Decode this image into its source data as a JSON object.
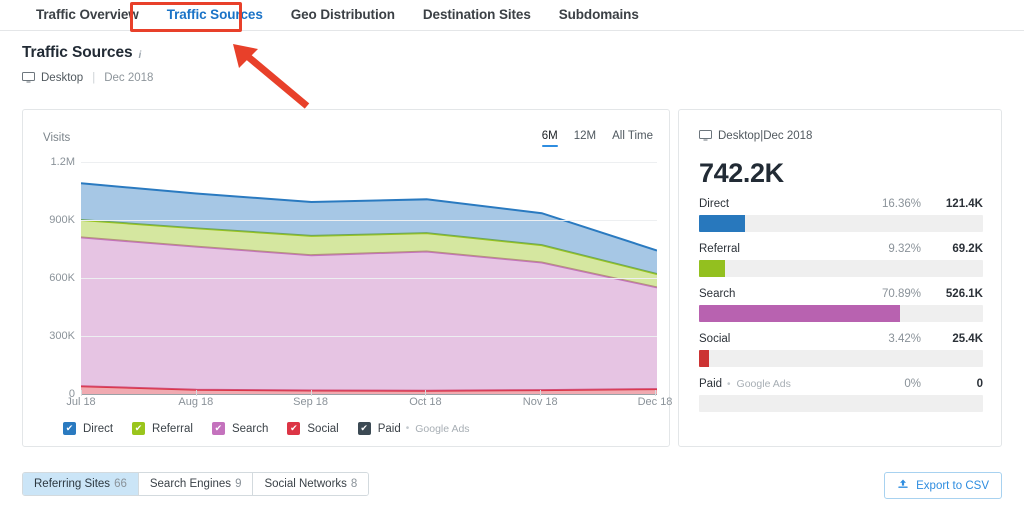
{
  "tabs": [
    {
      "label": "Traffic Overview",
      "active": false
    },
    {
      "label": "Traffic Sources",
      "active": true
    },
    {
      "label": "Geo Distribution",
      "active": false
    },
    {
      "label": "Destination Sites",
      "active": false
    },
    {
      "label": "Subdomains",
      "active": false
    }
  ],
  "page": {
    "title": "Traffic Sources",
    "info_icon": "i",
    "device": "Desktop",
    "separator": "|",
    "period": "Dec 2018"
  },
  "chart_card": {
    "axis_title": "Visits",
    "ranges": [
      {
        "label": "6M",
        "active": true
      },
      {
        "label": "12M",
        "active": false
      },
      {
        "label": "All Time",
        "active": false
      }
    ]
  },
  "legend": [
    {
      "label": "Direct",
      "color": "#2a7ac0",
      "checked": true,
      "note": ""
    },
    {
      "label": "Referral",
      "color": "#9ac51c",
      "checked": true,
      "note": ""
    },
    {
      "label": "Search",
      "color": "#c472bd",
      "checked": true,
      "note": ""
    },
    {
      "label": "Social",
      "color": "#dc3545",
      "checked": true,
      "note": ""
    },
    {
      "label": "Paid",
      "color": "#3c4a54",
      "checked": true,
      "note": "Google Ads"
    }
  ],
  "stats": {
    "device": "Desktop",
    "separator": "|",
    "period": "Dec 2018",
    "total": "742.2K",
    "rows": [
      {
        "name": "Direct",
        "sub": "",
        "percent": "16.36%",
        "value": "121.4K",
        "bar_pct": 16.36,
        "color": "#2878bd"
      },
      {
        "name": "Referral",
        "sub": "",
        "percent": "9.32%",
        "value": "69.2K",
        "bar_pct": 9.32,
        "color": "#93c01f"
      },
      {
        "name": "Search",
        "sub": "",
        "percent": "70.89%",
        "value": "526.1K",
        "bar_pct": 70.89,
        "color": "#b862b0"
      },
      {
        "name": "Social",
        "sub": "",
        "percent": "3.42%",
        "value": "25.4K",
        "bar_pct": 3.42,
        "color": "#cc3333"
      },
      {
        "name": "Paid",
        "sub": "Google Ads",
        "percent": "0%",
        "value": "0",
        "bar_pct": 0,
        "color": "#3c4a54"
      }
    ]
  },
  "bottom": {
    "segments": [
      {
        "label": "Referring Sites",
        "count": "66",
        "active": true
      },
      {
        "label": "Search Engines",
        "count": "9",
        "active": false
      },
      {
        "label": "Social Networks",
        "count": "8",
        "active": false
      }
    ],
    "export_label": "Export to CSV",
    "export_icon": "upload-icon"
  },
  "annotation": {
    "color": "#e8402a",
    "highlight_target": "Traffic Sources",
    "arrow_from_x": 307,
    "arrow_from_y": 106,
    "arrow_to_x": 233,
    "arrow_to_y": 44
  },
  "chart_data": {
    "type": "area",
    "stacked": true,
    "title": "",
    "xlabel": "",
    "ylabel": "Visits",
    "categories": [
      "Jul 18",
      "Aug 18",
      "Sep 18",
      "Oct 18",
      "Nov 18",
      "Dec 18"
    ],
    "ylim": [
      0,
      1200000
    ],
    "yticks": [
      0,
      300000,
      600000,
      900000,
      1200000
    ],
    "ytick_labels": [
      "0",
      "300K",
      "600K",
      "900K",
      "1.2M"
    ],
    "grid": true,
    "legend_position": "bottom",
    "stack_order_bottom_to_top": [
      "Social",
      "Search",
      "Referral",
      "Direct"
    ],
    "series": [
      {
        "name": "Social",
        "color": "#dc3545",
        "values": [
          40000,
          22000,
          18000,
          17000,
          20000,
          25400
        ]
      },
      {
        "name": "Search",
        "color": "#c472bd",
        "values": [
          770000,
          740000,
          700000,
          720000,
          660000,
          526100
        ]
      },
      {
        "name": "Referral",
        "color": "#9ac51c",
        "values": [
          90000,
          95000,
          100000,
          95000,
          90000,
          69200
        ]
      },
      {
        "name": "Direct",
        "color": "#2a7ac0",
        "values": [
          190000,
          180000,
          175000,
          175000,
          165000,
          121400
        ]
      },
      {
        "name": "Paid",
        "color": "#3c4a54",
        "values": [
          0,
          0,
          0,
          0,
          0,
          0
        ]
      }
    ]
  }
}
